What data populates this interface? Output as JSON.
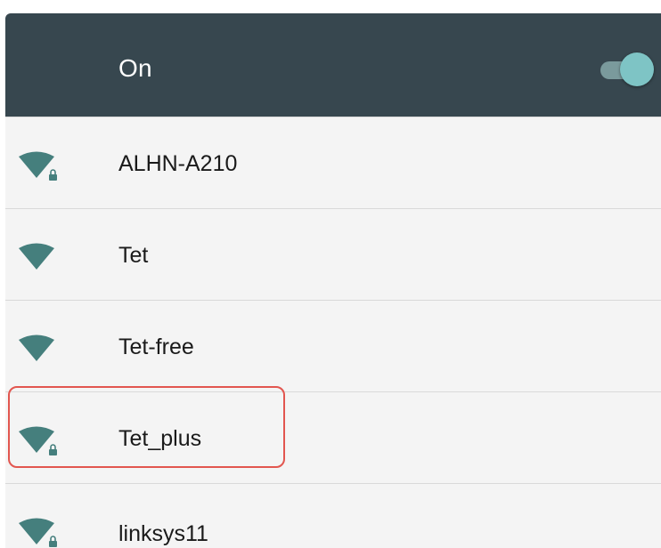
{
  "header": {
    "label": "On",
    "toggle_on": true,
    "background": "#37474f",
    "toggle_color": "#7ec4c5"
  },
  "networks": [
    {
      "name": "ALHN-A210",
      "secured": true,
      "icon": "wifi-lock-icon"
    },
    {
      "name": "Tet",
      "secured": false,
      "icon": "wifi-icon"
    },
    {
      "name": "Tet-free",
      "secured": false,
      "icon": "wifi-icon"
    },
    {
      "name": "Tet_plus",
      "secured": true,
      "icon": "wifi-lock-icon",
      "highlighted": true
    },
    {
      "name": "linksys11",
      "secured": true,
      "icon": "wifi-lock-icon"
    }
  ],
  "colors": {
    "wifi_icon": "#457f7d",
    "highlight_border": "#e2564f",
    "list_background": "#f4f4f4"
  }
}
